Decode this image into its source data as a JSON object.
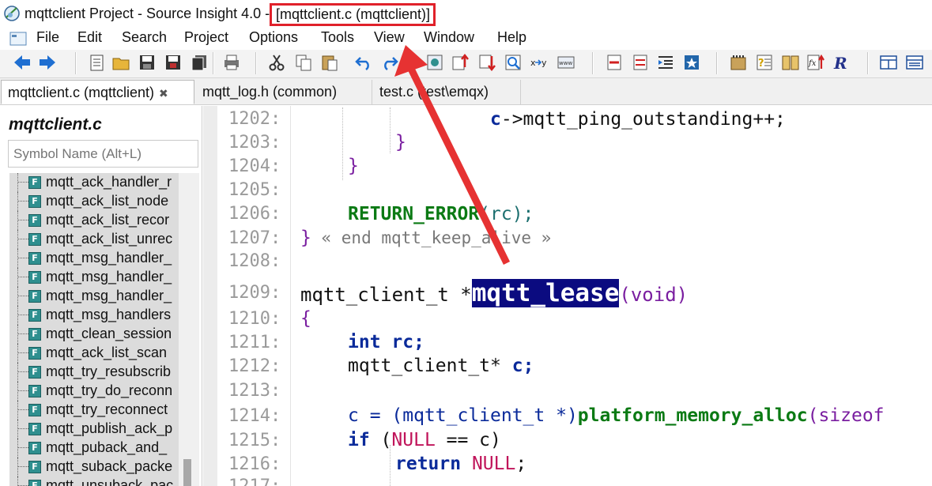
{
  "window": {
    "title": "mqttclient Project - Source Insight 4.0 -",
    "current_file": "[mqttclient.c (mqttclient)]"
  },
  "menu": [
    "File",
    "Edit",
    "Search",
    "Project",
    "Options",
    "Tools",
    "View",
    "Window",
    "Help"
  ],
  "tabs": [
    {
      "label": "mqttclient.c (mqttclient)",
      "close": "✖",
      "active": true
    },
    {
      "label": "mqtt_log.h (common)",
      "active": false
    },
    {
      "label": "test.c (test\\emqx)",
      "active": false
    }
  ],
  "symbol_panel": {
    "title": "mqttclient.c",
    "search_placeholder": "Symbol Name (Alt+L)",
    "symbols": [
      "mqtt_ack_handler_r",
      "mqtt_ack_list_node",
      "mqtt_ack_list_recor",
      "mqtt_ack_list_unrec",
      "mqtt_msg_handler_",
      "mqtt_msg_handler_",
      "mqtt_msg_handler_",
      "mqtt_msg_handlers",
      "mqtt_clean_session",
      "mqtt_ack_list_scan",
      "mqtt_try_resubscrib",
      "mqtt_try_do_reconn",
      "mqtt_try_reconnect",
      "mqtt_publish_ack_p",
      "mqtt_puback_and_",
      "mqtt_suback_packe",
      "mqtt_unsuback_pac"
    ]
  },
  "editor": {
    "line_numbers": [
      "1202:",
      "1203:",
      "1204:",
      "1205:",
      "1206:",
      "1207:",
      "1208:",
      "1209:",
      "1210:",
      "1211:",
      "1212:",
      "1213:",
      "1214:",
      "1215:",
      "1216:",
      "1217:"
    ],
    "highlighted_symbol": "mqtt_lease",
    "code": {
      "l1202_var": "c",
      "l1202_rest": "->mqtt_ping_outstanding++;",
      "l1203": "}",
      "l1204": "}",
      "l1206_fn": "RETURN_ERROR",
      "l1206_rest": "(rc);",
      "l1207_brace": "}",
      "l1207_cmt": " « end mqtt_keep_alive »",
      "l1209_type": "mqtt_client_t *",
      "l1209_args": "(void)",
      "l1210": "{",
      "l1211_kw": "int",
      "l1211_var": "rc;",
      "l1212_type": "mqtt_client_t*",
      "l1212_var": "c;",
      "l1214_pre": "c = (mqtt_client_t *)",
      "l1214_fn": "platform_memory_alloc",
      "l1214_rest": "(sizeof",
      "l1215_kw": "if",
      "l1215_open": " (",
      "l1215_mac": "NULL",
      "l1215_rest": " == c)",
      "l1216_kw": "return",
      "l1216_mac": "NULL",
      "l1216_end": ";"
    }
  },
  "colors": {
    "annotation_red": "#e0212a",
    "highlight_bg": "#0b0b80",
    "keyword": "#0a2a9a",
    "function": "#0b7a14"
  }
}
